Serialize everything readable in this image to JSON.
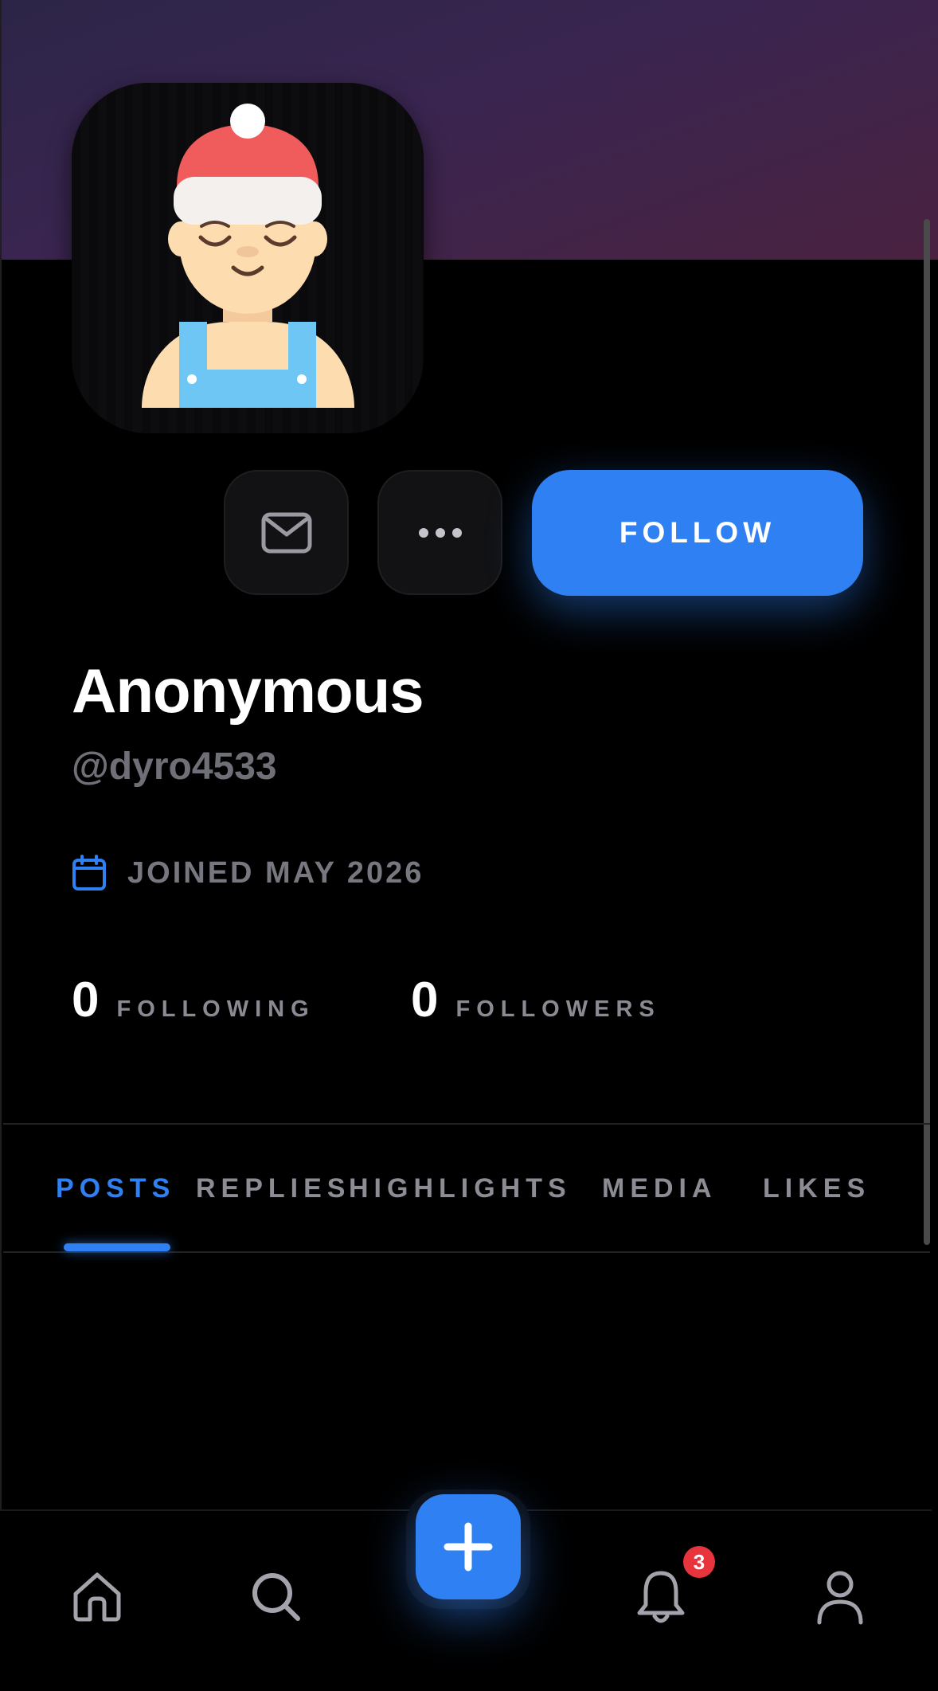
{
  "profile": {
    "display_name": "Anonymous",
    "handle": "@dyro4533",
    "joined": "JOINED MAY 2026",
    "avatar_icon": "person-with-santa-hat-avatar"
  },
  "actions": {
    "message_icon": "mail-icon",
    "more_icon": "more-horizontal-icon",
    "follow_label": "FOLLOW"
  },
  "stats": {
    "following_count": "0",
    "following_label": "FOLLOWING",
    "followers_count": "0",
    "followers_label": "FOLLOWERS"
  },
  "tabs": [
    {
      "label": "POSTS",
      "active": true
    },
    {
      "label": "REPLIES",
      "active": false
    },
    {
      "label": "HIGHLIGHTS",
      "active": false
    },
    {
      "label": "MEDIA",
      "active": false
    },
    {
      "label": "LIKES",
      "active": false
    }
  ],
  "bottom_nav": {
    "items": [
      "home-icon",
      "search-icon",
      "compose-plus-icon",
      "bell-icon",
      "profile-icon"
    ],
    "notification_badge": "3"
  },
  "colors": {
    "accent": "#2f80f2",
    "badge": "#e8343c",
    "banner_start": "#2c2548",
    "banner_end": "#4a2240"
  }
}
